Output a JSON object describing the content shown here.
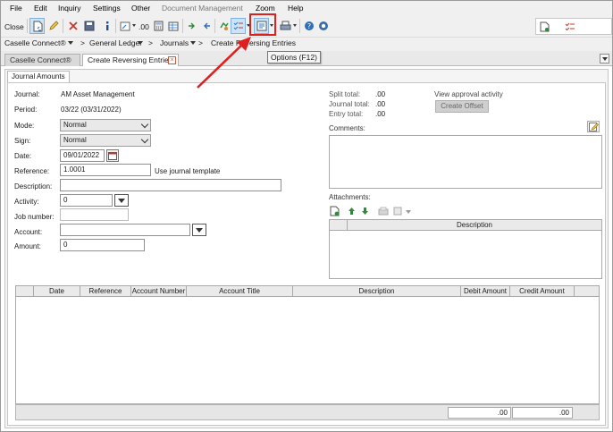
{
  "menu": {
    "items": [
      "File",
      "Edit",
      "Inquiry",
      "Settings",
      "Other",
      "Document Management",
      "Zoom",
      "Help"
    ]
  },
  "toolbar": {
    "close_label": "Close",
    "decimals_label": ".00",
    "tooltip": "Options (F12)"
  },
  "breadcrumb": [
    "Caselle Connect®",
    ">",
    "General Ledger",
    ">",
    "Journals",
    ">",
    "Create Reversing Entries"
  ],
  "tabs": [
    {
      "label": "Caselle Connect®"
    },
    {
      "label": "Create Reversing Entries"
    }
  ],
  "form": {
    "section_tab": "Journal Amounts",
    "journal": {
      "label": "Journal:",
      "value": "AM Asset Management"
    },
    "period": {
      "label": "Period:",
      "value": "03/22 (03/31/2022)"
    },
    "mode": {
      "label": "Mode:",
      "value": "Normal"
    },
    "sign": {
      "label": "Sign:",
      "value": "Normal"
    },
    "date": {
      "label": "Date:",
      "value": "09/01/2022"
    },
    "reference": {
      "label": "Reference:",
      "value": "1.0001",
      "template_label": "Use journal template"
    },
    "description": {
      "label": "Description:",
      "value": ""
    },
    "activity": {
      "label": "Activity:",
      "value": "0"
    },
    "job_number": {
      "label": "Job number:",
      "value": ""
    },
    "account": {
      "label": "Account:",
      "value": ""
    },
    "amount": {
      "label": "Amount:",
      "value": "0"
    }
  },
  "totals": {
    "split": {
      "label": "Split total:",
      "value": ".00"
    },
    "journal": {
      "label": "Journal total:",
      "value": ".00"
    },
    "entry": {
      "label": "Entry total:",
      "value": ".00"
    },
    "view_approval": "View approval activity",
    "create_offset": "Create Offset"
  },
  "comments": {
    "label": "Comments:"
  },
  "attachments": {
    "label": "Attachments:",
    "column": "Description"
  },
  "grid": {
    "columns": [
      "Date",
      "Reference",
      "Account Number",
      "Account Title",
      "Description",
      "Debit Amount",
      "Credit Amount"
    ],
    "debit_total": ".00",
    "credit_total": ".00"
  },
  "colors": {
    "highlight": "#e0201e",
    "selected_button": "#cde4f7"
  }
}
